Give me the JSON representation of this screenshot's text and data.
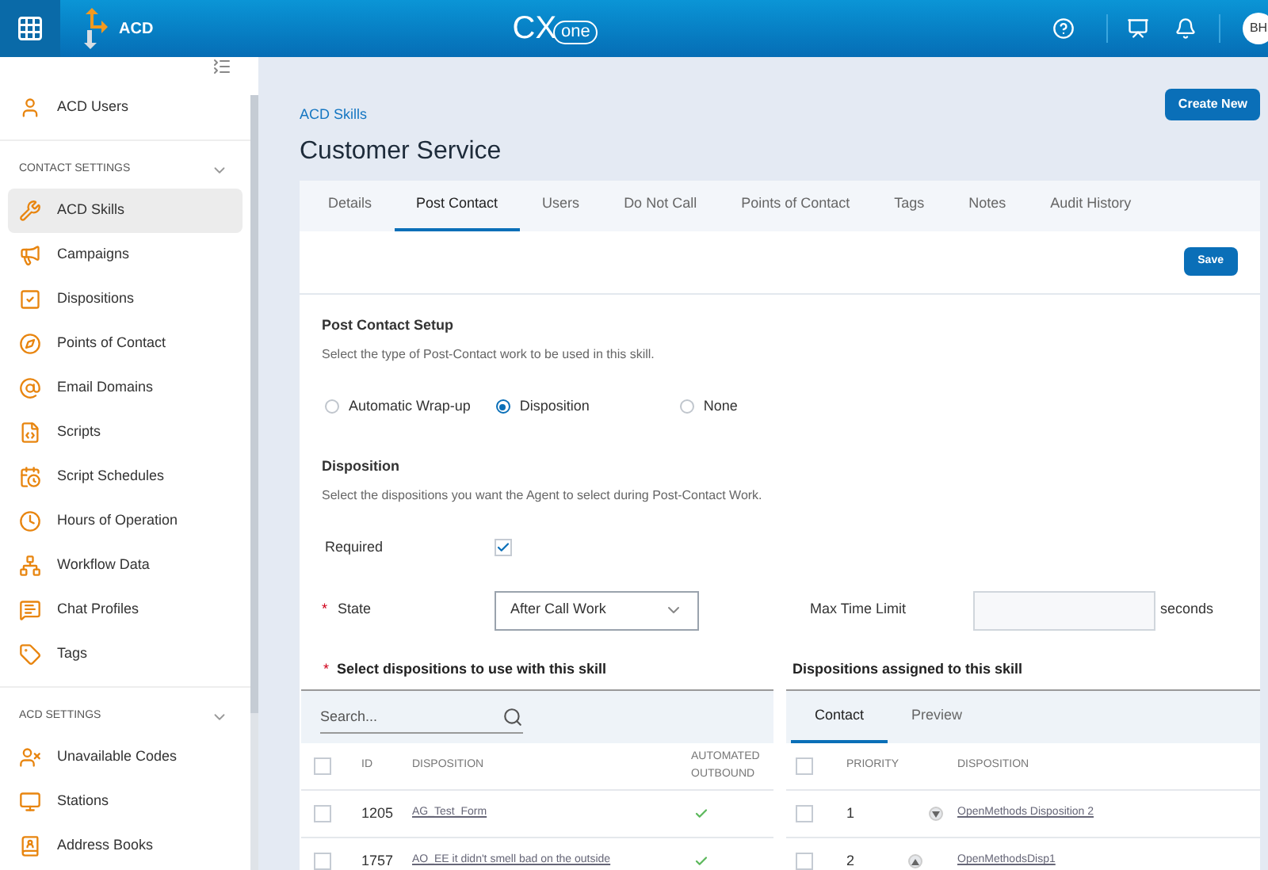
{
  "header": {
    "app_name": "ACD",
    "logo_text": "CX",
    "logo_subtext": "one",
    "avatar": "BH"
  },
  "sidebar": {
    "top_items": [
      {
        "label": "ACD Users",
        "selected": false
      }
    ],
    "sections": [
      {
        "title": "CONTACT SETTINGS",
        "expanded": true,
        "items": [
          {
            "label": "ACD Skills",
            "selected": true
          },
          {
            "label": "Campaigns",
            "selected": false
          },
          {
            "label": "Dispositions",
            "selected": false
          },
          {
            "label": "Points of Contact",
            "selected": false
          },
          {
            "label": "Email Domains",
            "selected": false
          },
          {
            "label": "Scripts",
            "selected": false
          },
          {
            "label": "Script Schedules",
            "selected": false
          },
          {
            "label": "Hours of Operation",
            "selected": false
          },
          {
            "label": "Workflow Data",
            "selected": false
          },
          {
            "label": "Chat Profiles",
            "selected": false
          },
          {
            "label": "Tags",
            "selected": false
          }
        ]
      },
      {
        "title": "ACD SETTINGS",
        "expanded": true,
        "items": [
          {
            "label": "Unavailable Codes",
            "selected": false
          },
          {
            "label": "Stations",
            "selected": false
          },
          {
            "label": "Address Books",
            "selected": false
          }
        ]
      }
    ]
  },
  "breadcrumb": "ACD Skills",
  "title": "Customer Service",
  "create_button": "Create New",
  "tabs": [
    {
      "label": "Details",
      "selected": false
    },
    {
      "label": "Post Contact",
      "selected": true
    },
    {
      "label": "Users",
      "selected": false
    },
    {
      "label": "Do Not Call",
      "selected": false
    },
    {
      "label": "Points of Contact",
      "selected": false
    },
    {
      "label": "Tags",
      "selected": false
    },
    {
      "label": "Notes",
      "selected": false
    },
    {
      "label": "Audit History",
      "selected": false
    }
  ],
  "save_button": "Save",
  "setup": {
    "title": "Post Contact Setup",
    "description": "Select the type of Post-Contact work to be used in this skill.",
    "options": [
      {
        "label": "Automatic Wrap-up",
        "selected": false
      },
      {
        "label": "Disposition",
        "selected": true
      },
      {
        "label": "None",
        "selected": false
      }
    ]
  },
  "disposition": {
    "title": "Disposition",
    "description": "Select the dispositions you want the Agent to select during Post-Contact Work.",
    "required_label": "Required",
    "required_checked": true,
    "required_mark": "*",
    "state_label": "State",
    "state_value": "After Call Work",
    "max_time_label": "Max Time Limit",
    "max_time_unit": "seconds"
  },
  "available": {
    "title": "Select dispositions to use with this skill",
    "search_placeholder": "Search...",
    "all_checked": false,
    "columns": [
      "ID",
      "DISPOSITION",
      "AUTOMATED OUTBOUND"
    ],
    "rows": [
      {
        "checked": false,
        "id": "1205",
        "disposition": "AG_Test_Form",
        "automated_outbound": true
      },
      {
        "checked": false,
        "id": "1757",
        "disposition": "AO_EE it didn't smell bad on the outside",
        "automated_outbound": true
      }
    ]
  },
  "assigned": {
    "title": "Dispositions assigned to this skill",
    "tabs": [
      {
        "label": "Contact",
        "selected": true
      },
      {
        "label": "Preview",
        "selected": false
      }
    ],
    "all_checked": false,
    "columns": [
      "PRIORITY",
      "DISPOSITION"
    ],
    "rows": [
      {
        "checked": false,
        "priority": "1",
        "move_up": false,
        "disposition": "OpenMethods Disposition 2"
      },
      {
        "checked": false,
        "priority": "2",
        "move_up": true,
        "disposition": "OpenMethodsDisp1"
      }
    ]
  }
}
